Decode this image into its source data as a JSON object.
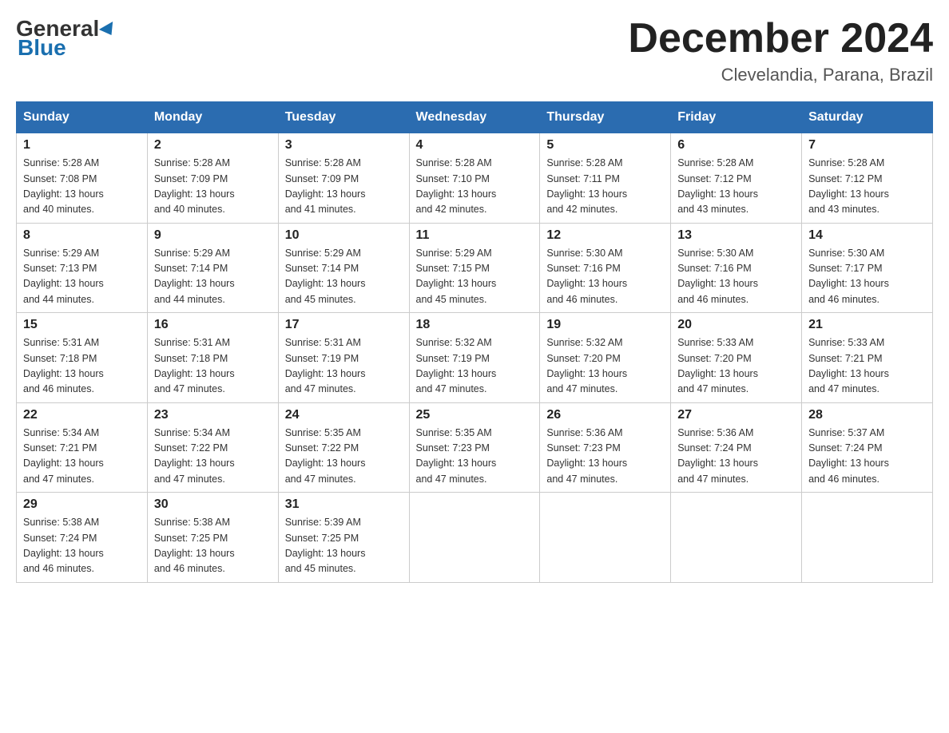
{
  "header": {
    "logo_general": "General",
    "logo_blue": "Blue",
    "month_title": "December 2024",
    "location": "Clevelandia, Parana, Brazil"
  },
  "days_of_week": [
    "Sunday",
    "Monday",
    "Tuesday",
    "Wednesday",
    "Thursday",
    "Friday",
    "Saturday"
  ],
  "weeks": [
    [
      {
        "day": "1",
        "sunrise": "5:28 AM",
        "sunset": "7:08 PM",
        "daylight": "13 hours and 40 minutes."
      },
      {
        "day": "2",
        "sunrise": "5:28 AM",
        "sunset": "7:09 PM",
        "daylight": "13 hours and 40 minutes."
      },
      {
        "day": "3",
        "sunrise": "5:28 AM",
        "sunset": "7:09 PM",
        "daylight": "13 hours and 41 minutes."
      },
      {
        "day": "4",
        "sunrise": "5:28 AM",
        "sunset": "7:10 PM",
        "daylight": "13 hours and 42 minutes."
      },
      {
        "day": "5",
        "sunrise": "5:28 AM",
        "sunset": "7:11 PM",
        "daylight": "13 hours and 42 minutes."
      },
      {
        "day": "6",
        "sunrise": "5:28 AM",
        "sunset": "7:12 PM",
        "daylight": "13 hours and 43 minutes."
      },
      {
        "day": "7",
        "sunrise": "5:28 AM",
        "sunset": "7:12 PM",
        "daylight": "13 hours and 43 minutes."
      }
    ],
    [
      {
        "day": "8",
        "sunrise": "5:29 AM",
        "sunset": "7:13 PM",
        "daylight": "13 hours and 44 minutes."
      },
      {
        "day": "9",
        "sunrise": "5:29 AM",
        "sunset": "7:14 PM",
        "daylight": "13 hours and 44 minutes."
      },
      {
        "day": "10",
        "sunrise": "5:29 AM",
        "sunset": "7:14 PM",
        "daylight": "13 hours and 45 minutes."
      },
      {
        "day": "11",
        "sunrise": "5:29 AM",
        "sunset": "7:15 PM",
        "daylight": "13 hours and 45 minutes."
      },
      {
        "day": "12",
        "sunrise": "5:30 AM",
        "sunset": "7:16 PM",
        "daylight": "13 hours and 46 minutes."
      },
      {
        "day": "13",
        "sunrise": "5:30 AM",
        "sunset": "7:16 PM",
        "daylight": "13 hours and 46 minutes."
      },
      {
        "day": "14",
        "sunrise": "5:30 AM",
        "sunset": "7:17 PM",
        "daylight": "13 hours and 46 minutes."
      }
    ],
    [
      {
        "day": "15",
        "sunrise": "5:31 AM",
        "sunset": "7:18 PM",
        "daylight": "13 hours and 46 minutes."
      },
      {
        "day": "16",
        "sunrise": "5:31 AM",
        "sunset": "7:18 PM",
        "daylight": "13 hours and 47 minutes."
      },
      {
        "day": "17",
        "sunrise": "5:31 AM",
        "sunset": "7:19 PM",
        "daylight": "13 hours and 47 minutes."
      },
      {
        "day": "18",
        "sunrise": "5:32 AM",
        "sunset": "7:19 PM",
        "daylight": "13 hours and 47 minutes."
      },
      {
        "day": "19",
        "sunrise": "5:32 AM",
        "sunset": "7:20 PM",
        "daylight": "13 hours and 47 minutes."
      },
      {
        "day": "20",
        "sunrise": "5:33 AM",
        "sunset": "7:20 PM",
        "daylight": "13 hours and 47 minutes."
      },
      {
        "day": "21",
        "sunrise": "5:33 AM",
        "sunset": "7:21 PM",
        "daylight": "13 hours and 47 minutes."
      }
    ],
    [
      {
        "day": "22",
        "sunrise": "5:34 AM",
        "sunset": "7:21 PM",
        "daylight": "13 hours and 47 minutes."
      },
      {
        "day": "23",
        "sunrise": "5:34 AM",
        "sunset": "7:22 PM",
        "daylight": "13 hours and 47 minutes."
      },
      {
        "day": "24",
        "sunrise": "5:35 AM",
        "sunset": "7:22 PM",
        "daylight": "13 hours and 47 minutes."
      },
      {
        "day": "25",
        "sunrise": "5:35 AM",
        "sunset": "7:23 PM",
        "daylight": "13 hours and 47 minutes."
      },
      {
        "day": "26",
        "sunrise": "5:36 AM",
        "sunset": "7:23 PM",
        "daylight": "13 hours and 47 minutes."
      },
      {
        "day": "27",
        "sunrise": "5:36 AM",
        "sunset": "7:24 PM",
        "daylight": "13 hours and 47 minutes."
      },
      {
        "day": "28",
        "sunrise": "5:37 AM",
        "sunset": "7:24 PM",
        "daylight": "13 hours and 46 minutes."
      }
    ],
    [
      {
        "day": "29",
        "sunrise": "5:38 AM",
        "sunset": "7:24 PM",
        "daylight": "13 hours and 46 minutes."
      },
      {
        "day": "30",
        "sunrise": "5:38 AM",
        "sunset": "7:25 PM",
        "daylight": "13 hours and 46 minutes."
      },
      {
        "day": "31",
        "sunrise": "5:39 AM",
        "sunset": "7:25 PM",
        "daylight": "13 hours and 45 minutes."
      },
      null,
      null,
      null,
      null
    ]
  ],
  "labels": {
    "sunrise": "Sunrise:",
    "sunset": "Sunset:",
    "daylight": "Daylight:"
  }
}
